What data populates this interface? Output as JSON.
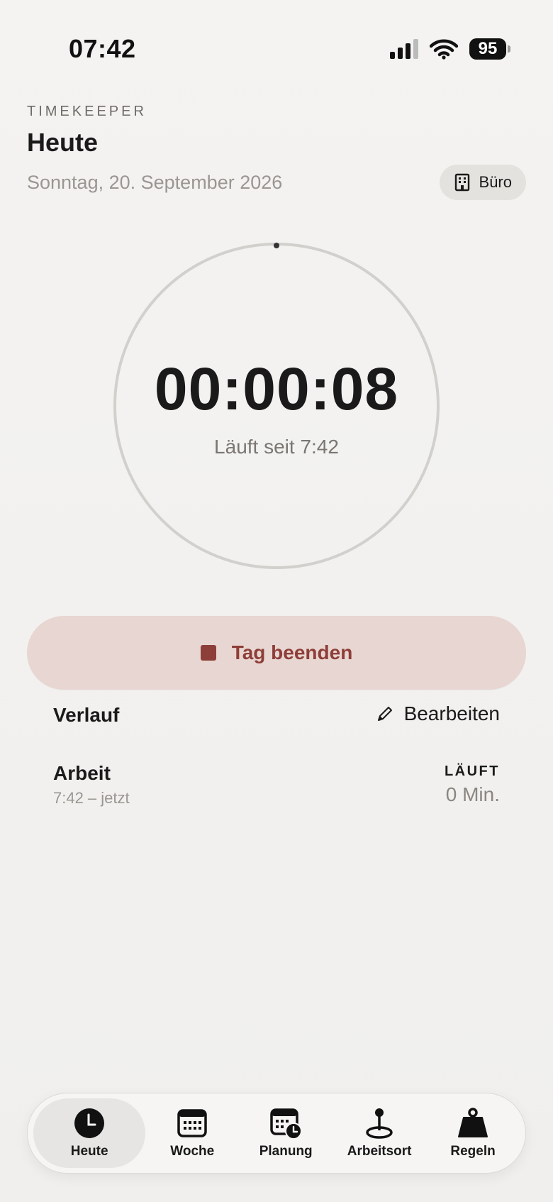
{
  "status_bar": {
    "time": "07:42",
    "battery": "95"
  },
  "header": {
    "app_label": "TIMEKEEPER",
    "title": "Heute",
    "date": "Sonntag, 20. September 2026",
    "location_chip": {
      "label": "Büro",
      "icon": "building-icon"
    }
  },
  "timer": {
    "value": "00:00:08",
    "subtitle": "Läuft seit 7:42"
  },
  "end_button": {
    "label": "Tag beenden",
    "icon": "stop-icon",
    "color": "#8e3e38",
    "background": "#e8d6d2"
  },
  "history": {
    "title": "Verlauf",
    "edit_label": "Bearbeiten",
    "entries": [
      {
        "name": "Arbeit",
        "range": "7:42 – jetzt",
        "status": "LÄUFT",
        "duration": "0 Min."
      }
    ]
  },
  "tabs": [
    {
      "label": "Heute",
      "icon": "clock-icon",
      "active": true
    },
    {
      "label": "Woche",
      "icon": "calendar-icon",
      "active": false
    },
    {
      "label": "Planung",
      "icon": "calendar-clock-icon",
      "active": false
    },
    {
      "label": "Arbeitsort",
      "icon": "location-pin-icon",
      "active": false
    },
    {
      "label": "Regeln",
      "icon": "weight-icon",
      "active": false
    }
  ]
}
